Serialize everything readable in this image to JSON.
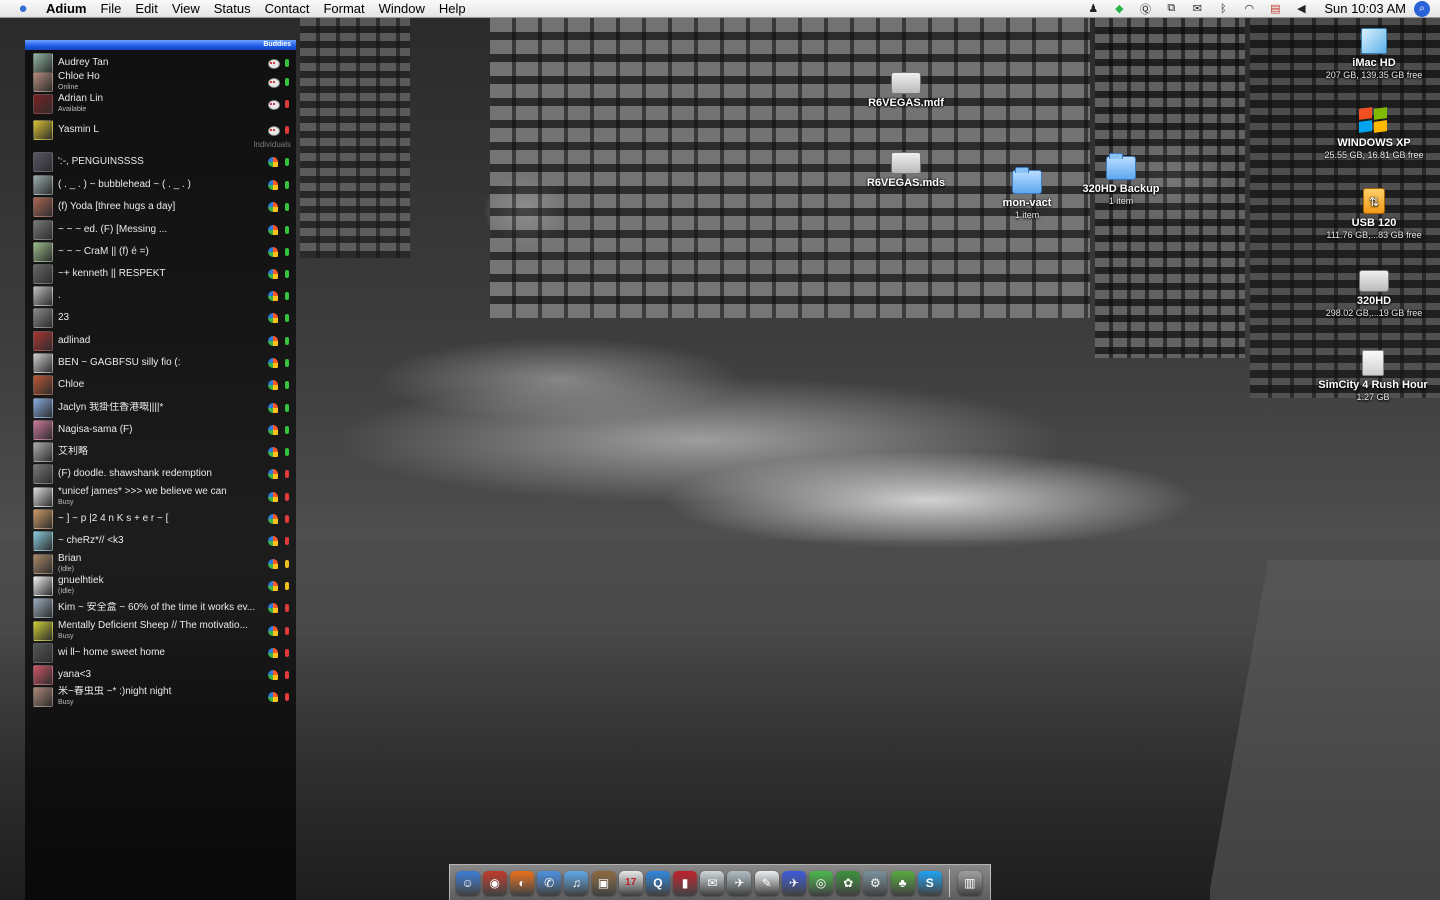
{
  "menubar": {
    "app_name": "Adium",
    "menus": [
      "File",
      "Edit",
      "View",
      "Status",
      "Contact",
      "Format",
      "Window",
      "Help"
    ],
    "clock": "Sun 10:03 AM",
    "status_icons": [
      "adium-icon",
      "growl-icon",
      "quicksilver-icon",
      "spaces-icon",
      "mail-icon",
      "bluetooth-icon",
      "wifi-icon",
      "flag-icon",
      "volume-icon"
    ]
  },
  "buddylist": {
    "header": "Buddies",
    "group_individuals": "Individuals",
    "contacts": [
      {
        "name": "Audrey Tan",
        "status": "",
        "service": "aim",
        "dot": "#35c43c"
      },
      {
        "name": "Chloe Ho",
        "status": "Online",
        "service": "aim",
        "dot": "#35c43c"
      },
      {
        "name": "Adrian Lin",
        "status": "Available",
        "service": "aim",
        "dot": "#e23b3b"
      },
      {
        "name": "Yasmin L",
        "status": "",
        "service": "aim",
        "dot": "#e23b3b"
      },
      {
        "name": "':-, PENGUINSSSS",
        "status": "",
        "service": "msn",
        "dot": "#35c43c"
      },
      {
        "name": "( . _ .   ) ~ bubblehead ~ (   . _ . )",
        "status": "",
        "service": "msn",
        "dot": "#35c43c"
      },
      {
        "name": "(f) Yoda [three hugs a day]",
        "status": "",
        "service": "msn",
        "dot": "#35c43c"
      },
      {
        "name": "~   ~   ~         ed.          (F)          [Messing ...",
        "status": "",
        "service": "msn",
        "dot": "#35c43c"
      },
      {
        "name": "~ ~ ~ CraM || (f) é =)",
        "status": "",
        "service": "msn",
        "dot": "#35c43c"
      },
      {
        "name": "~+ kenneth || RESPEKT",
        "status": "",
        "service": "msn",
        "dot": "#35c43c"
      },
      {
        "name": ".",
        "status": "",
        "service": "msn",
        "dot": "#35c43c"
      },
      {
        "name": "23",
        "status": "",
        "service": "msn",
        "dot": "#35c43c"
      },
      {
        "name": "adlinad",
        "status": "",
        "service": "msn",
        "dot": "#35c43c"
      },
      {
        "name": "BEN ~ GAGBFSU silly fio (:",
        "status": "",
        "service": "msn",
        "dot": "#35c43c"
      },
      {
        "name": "Chloe",
        "status": "",
        "service": "msn",
        "dot": "#35c43c"
      },
      {
        "name": "Jaclyn    我掛住香港嘅||||*",
        "status": "",
        "service": "msn",
        "dot": "#35c43c"
      },
      {
        "name": "Nagisa-sama (F)",
        "status": "",
        "service": "msn",
        "dot": "#35c43c"
      },
      {
        "name": "艾利略",
        "status": "",
        "service": "msn",
        "dot": "#35c43c"
      },
      {
        "name": "(F) doodle. shawshank redemption",
        "status": "",
        "service": "msn",
        "dot": "#e23b3b"
      },
      {
        "name": "*unicef  james* >>>    we believe we can",
        "status": "Busy",
        "service": "msn",
        "dot": "#e23b3b"
      },
      {
        "name": "~ ] ~ p |2 4 n K s + e r ~ [",
        "status": "",
        "service": "msn",
        "dot": "#e23b3b"
      },
      {
        "name": "~ cheRz*//      <k3",
        "status": "",
        "service": "msn",
        "dot": "#e23b3b"
      },
      {
        "name": "Brian",
        "status": "(Idle)",
        "service": "msn",
        "dot": "#f0c020"
      },
      {
        "name": "gnuelhtiek",
        "status": "(Idle)",
        "service": "msn",
        "dot": "#f0c020"
      },
      {
        "name": "Kim ~ 安全盒 ~ 60% of the time it works ev...",
        "status": "",
        "service": "msn",
        "dot": "#e23b3b"
      },
      {
        "name": "Mentally Deficient Sheep // The motivatio...",
        "status": "Busy",
        "service": "msn",
        "dot": "#e23b3b"
      },
      {
        "name": "wi ll~ home sweet home",
        "status": "",
        "service": "msn",
        "dot": "#e23b3b"
      },
      {
        "name": "yana<3",
        "status": "",
        "service": "msn",
        "dot": "#e23b3b"
      },
      {
        "name": "米~春虫虫 ~* :)night night",
        "status": "Busy",
        "service": "msn",
        "dot": "#e23b3b"
      }
    ]
  },
  "desktop_icons": [
    {
      "name": "R6VEGAS.mdf",
      "sub": "",
      "kind": "drive"
    },
    {
      "name": "R6VEGAS.mds",
      "sub": "",
      "kind": "drive"
    },
    {
      "name": "mon-vact",
      "sub": "1 item",
      "kind": "folder"
    },
    {
      "name": "320HD Backup",
      "sub": "1 item",
      "kind": "folder"
    },
    {
      "name": "iMac HD",
      "sub": "207 GB, 139.35 GB free",
      "kind": "imac"
    },
    {
      "name": "WINDOWS XP",
      "sub": "25.55 GB, 16.81 GB free",
      "kind": "xp"
    },
    {
      "name": "USB 120",
      "sub": "111.76 GB,...83 GB free",
      "kind": "usb"
    },
    {
      "name": "320HD",
      "sub": "298.02 GB,...19 GB free",
      "kind": "drive"
    },
    {
      "name": "SimCity 4 Rush Hour",
      "sub": "1.27 GB",
      "kind": "disk"
    }
  ],
  "dock": {
    "items": [
      {
        "name": "finder-icon",
        "color": "#3a7bd5",
        "glyph": "☺"
      },
      {
        "name": "safari-icon",
        "color": "#c0392b",
        "glyph": "◉"
      },
      {
        "name": "firefox-icon",
        "color": "#e8701a",
        "glyph": "◐"
      },
      {
        "name": "ichat-icon",
        "color": "#4a90e2",
        "glyph": "✆"
      },
      {
        "name": "itunes-icon",
        "color": "#5fa8e8",
        "glyph": "♫"
      },
      {
        "name": "iphoto-icon",
        "color": "#8b6a3e",
        "glyph": "▣"
      },
      {
        "name": "ical-icon",
        "color": "#e8e8e8",
        "glyph": "17"
      },
      {
        "name": "quicktime-icon",
        "color": "#2e86de",
        "glyph": "Q"
      },
      {
        "name": "photobooth-icon",
        "color": "#c0202a",
        "glyph": "▮"
      },
      {
        "name": "preview-icon",
        "color": "#cfd8dc",
        "glyph": "✉"
      },
      {
        "name": "mail-stamp-icon",
        "color": "#b0bec5",
        "glyph": "✈"
      },
      {
        "name": "textedit-icon",
        "color": "#eceff1",
        "glyph": "✎"
      },
      {
        "name": "xcode-icon",
        "color": "#3b5bdb",
        "glyph": "✈"
      },
      {
        "name": "limewire-icon",
        "color": "#49b84a",
        "glyph": "◎"
      },
      {
        "name": "msn-messenger-icon",
        "color": "#3a8f3a",
        "glyph": "✿"
      },
      {
        "name": "system-preferences-icon",
        "color": "#78909c",
        "glyph": "⚙"
      },
      {
        "name": "adium-duck-icon",
        "color": "#54a83c",
        "glyph": "♣"
      },
      {
        "name": "skype-icon",
        "color": "#1da1f2",
        "glyph": "S"
      },
      {
        "name": "trash-icon",
        "color": "#9e9e9e",
        "glyph": "▥"
      }
    ]
  }
}
